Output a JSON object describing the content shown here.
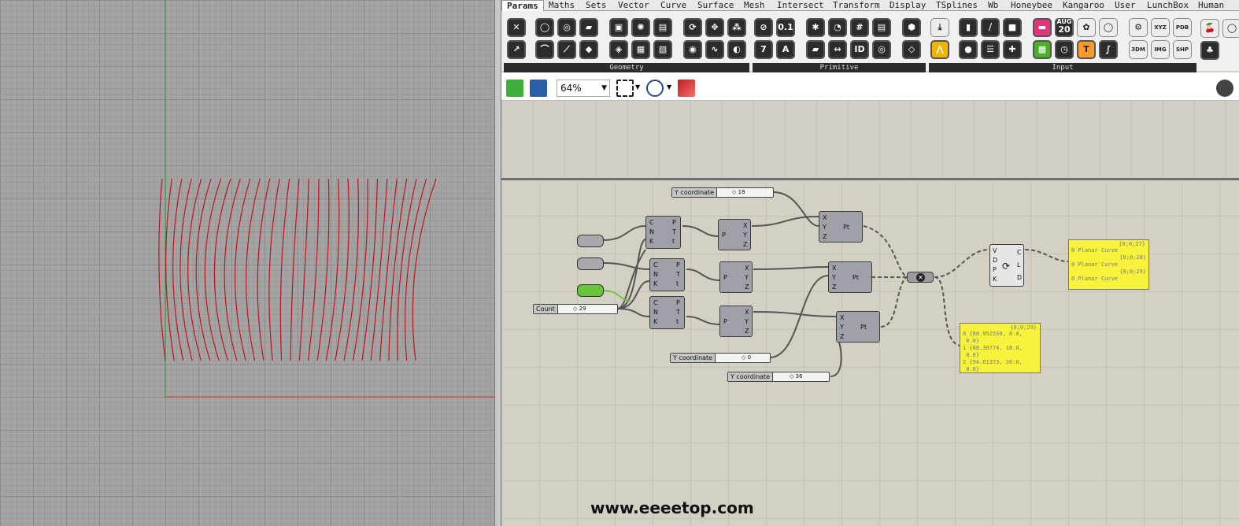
{
  "tabs": [
    {
      "label": "Params",
      "active": true
    },
    {
      "label": "Maths"
    },
    {
      "label": "Sets"
    },
    {
      "label": "Vector"
    },
    {
      "label": "Curve"
    },
    {
      "label": "Surface"
    },
    {
      "label": "Mesh"
    },
    {
      "label": "Intersect"
    },
    {
      "label": "Transform"
    },
    {
      "label": "Display"
    },
    {
      "label": "TSplines"
    },
    {
      "label": "Wb"
    },
    {
      "label": "Honeybee"
    },
    {
      "label": "Kangaroo"
    },
    {
      "label": "User"
    },
    {
      "label": "LunchBox"
    },
    {
      "label": "Human"
    }
  ],
  "ribbon": {
    "groups": [
      {
        "label": "Geometry"
      },
      {
        "label": "Primitive"
      },
      {
        "label": "Input"
      }
    ],
    "primitive_icon_labels": [
      "0.1",
      "7",
      "A",
      "ID"
    ],
    "input_icon_labels": {
      "date_month": "AUG",
      "date_day": "20",
      "xyz": "XYZ",
      "pdb": "PDB",
      "3dm": "3DM",
      "img": "IMG",
      "shp": "SHP"
    }
  },
  "toolbar": {
    "zoom": "64%"
  },
  "canvas": {
    "sliders": [
      {
        "name": "Y coordinate",
        "value": "18"
      },
      {
        "name": "Count",
        "value": "29"
      },
      {
        "name": "Y coordinate",
        "value": "0"
      },
      {
        "name": "Y coordinate",
        "value": "36"
      }
    ],
    "divide_inputs": [
      "C",
      "N",
      "K"
    ],
    "divide_outputs": [
      "P",
      "T",
      "t"
    ],
    "decon_input": "P",
    "decon_outputs": [
      "X",
      "Y",
      "Z"
    ],
    "construct_inputs": [
      "X",
      "Y",
      "Z"
    ],
    "construct_output": "Pt",
    "interp_inputs": [
      "V",
      "D",
      "P",
      "K"
    ],
    "interp_outputs": [
      "C",
      "L",
      "D"
    ],
    "panel_curves": {
      "header": "{0;0;27}",
      "rows": [
        {
          "index": "0",
          "text": "Planar Curve"
        },
        {
          "index": "",
          "text": "{0;0;28}"
        },
        {
          "index": "0",
          "text": "Planar Curve"
        },
        {
          "index": "",
          "text": "{0;0;29}"
        },
        {
          "index": "0",
          "text": "Planar Curve"
        }
      ]
    },
    "panel_points": {
      "header": "{0;0;29}",
      "rows": [
        {
          "index": "0",
          "text": "{80.952539, 0.0,"
        },
        {
          "index": "",
          "text": "0.0}"
        },
        {
          "index": "1",
          "text": "{88.30774, 18.0,"
        },
        {
          "index": "",
          "text": "0.0}"
        },
        {
          "index": "2",
          "text": "{94.61373, 36.0,"
        },
        {
          "index": "",
          "text": "0.0}"
        }
      ]
    }
  },
  "watermark": "www.eeeetop.com",
  "colors": {
    "curves": "#c0141c",
    "axis_x": "#d03a3a",
    "axis_y": "#2aa02a",
    "panel": "#f7f23c",
    "node": "#a0a0a8"
  }
}
